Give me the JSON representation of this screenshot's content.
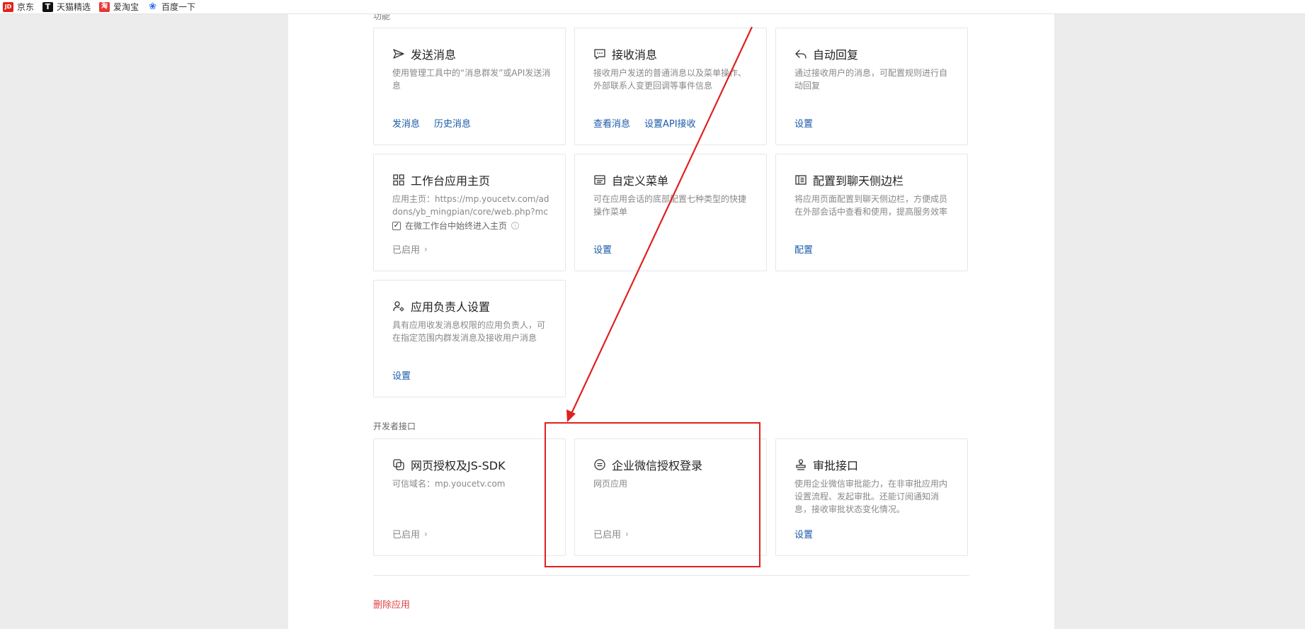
{
  "bookmarks": [
    {
      "icon": "jd-logo-icon",
      "badge": "JD",
      "label": "京东"
    },
    {
      "icon": "tmall-logo-icon",
      "badge": "T",
      "label": "天猫精选"
    },
    {
      "icon": "taobao-logo-icon",
      "badge": "淘",
      "label": "爱淘宝"
    },
    {
      "icon": "baidu-paw-icon",
      "badge": "❀",
      "label": "百度一下"
    }
  ],
  "top_section_label": "功能",
  "cards": {
    "send": {
      "icon": "send-icon",
      "title": "发送消息",
      "desc": "使用管理工具中的“消息群发”或API发送消息",
      "actions": [
        "发消息",
        "历史消息"
      ]
    },
    "receive": {
      "icon": "chat-bubble-icon",
      "title": "接收消息",
      "desc": "接收用户发送的普通消息以及菜单操作、外部联系人变更回调等事件信息",
      "actions": [
        "查看消息",
        "设置API接收"
      ]
    },
    "autoreply": {
      "icon": "reply-icon",
      "title": "自动回复",
      "desc": "通过接收用户的消息，可配置规则进行自动回复",
      "actions": [
        "设置"
      ]
    },
    "workbench": {
      "icon": "grid-icon",
      "title": "工作台应用主页",
      "desc": "应用主页：https://mp.youcetv.com/addons/yb_mingpian/core/web.php?mch_id=...",
      "checkbox_label": "在微工作台中始终进入主页",
      "checkbox_mark": "✓",
      "info_mark": "i",
      "status": "已启用",
      "chevron": "›"
    },
    "menu": {
      "icon": "menu-icon",
      "title": "自定义菜单",
      "desc": "可在应用会话的底部配置七种类型的快捷操作菜单",
      "actions": [
        "设置"
      ]
    },
    "sidebar": {
      "icon": "sidebar-icon",
      "title": "配置到聊天侧边栏",
      "desc": "将应用页面配置到聊天侧边栏，方便成员在外部会话中查看和使用，提高服务效率",
      "actions": [
        "配置"
      ]
    },
    "owner": {
      "icon": "user-gear-icon",
      "title": "应用负责人设置",
      "desc": "具有应用收发消息权限的应用负责人，可在指定范围内群发消息及接收用户消息",
      "actions": [
        "设置"
      ]
    },
    "jssdk": {
      "icon": "web-auth-icon",
      "title": "网页授权及JS-SDK",
      "desc": "可信域名：mp.youcetv.com",
      "status": "已启用",
      "chevron": "›"
    },
    "wxlogin": {
      "icon": "wecom-auth-icon",
      "title": "企业微信授权登录",
      "desc": "网页应用",
      "status": "已启用",
      "chevron": "›"
    },
    "approval": {
      "icon": "stamp-icon",
      "title": "审批接口",
      "desc": "使用企业微信审批能力，在非审批应用内设置流程、发起审批。还能订阅通知消息，接收审批状态变化情况。",
      "actions": [
        "设置"
      ]
    }
  },
  "dev_section_label": "开发者接口",
  "delete_label": "删除应用",
  "annotation_color": "#e02020"
}
